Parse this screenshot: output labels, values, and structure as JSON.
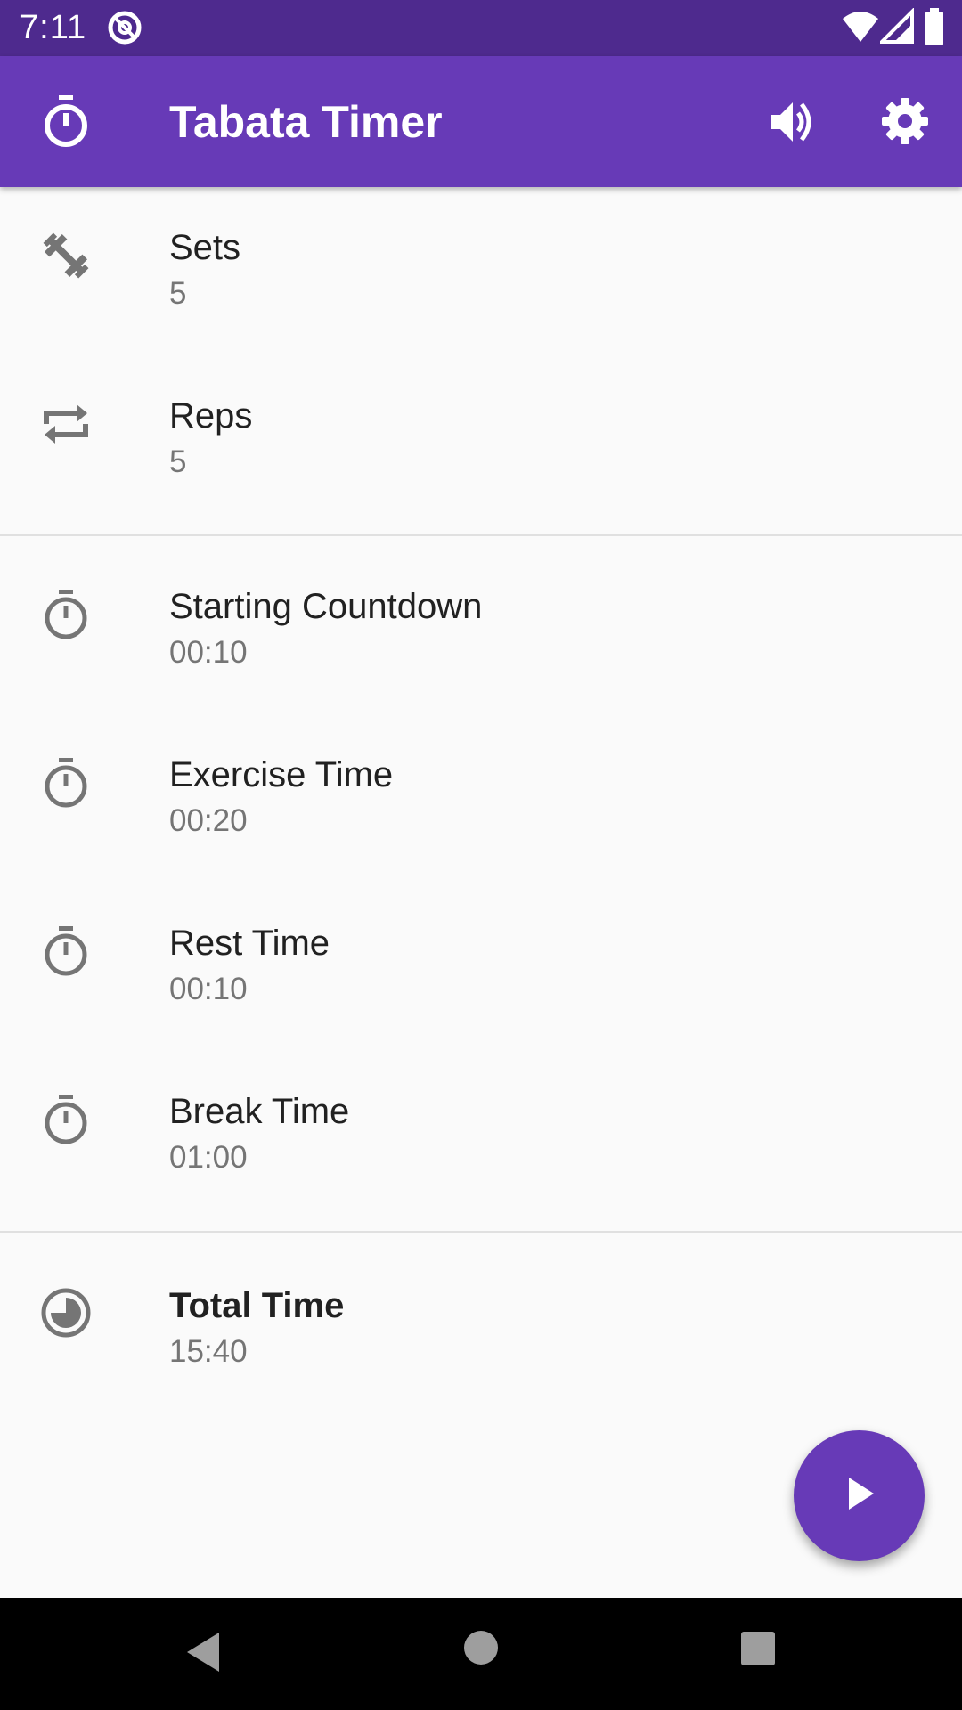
{
  "status_bar": {
    "time": "7:11",
    "icons": [
      "at-sign-icon",
      "wifi-icon",
      "signal-icon",
      "battery-icon"
    ]
  },
  "app_bar": {
    "title": "Tabata Timer",
    "leading_icon": "timer-icon",
    "actions": [
      "volume-up-icon",
      "settings-gear-icon"
    ]
  },
  "settings": [
    {
      "icon": "dumbbell-icon",
      "label": "Sets",
      "value": "5"
    },
    {
      "icon": "repeat-icon",
      "label": "Reps",
      "value": "5"
    },
    {
      "icon": "timer-icon",
      "label": "Starting Countdown",
      "value": "00:10"
    },
    {
      "icon": "timer-icon",
      "label": "Exercise Time",
      "value": "00:20"
    },
    {
      "icon": "timer-icon",
      "label": "Rest Time",
      "value": "00:10"
    },
    {
      "icon": "timer-icon",
      "label": "Break Time",
      "value": "01:00"
    }
  ],
  "total": {
    "icon": "clock-pie-icon",
    "label": "Total Time",
    "value": "15:40"
  },
  "fab": {
    "icon": "play-icon"
  },
  "nav_bar": {
    "icons": [
      "back-triangle-icon",
      "home-circle-icon",
      "recents-square-icon"
    ]
  },
  "colors": {
    "primary": "#673ab7",
    "primary_dark": "#4e2a8e",
    "background": "#fafafa",
    "text_primary": "#212121",
    "text_secondary": "#757575",
    "icon_gray": "#757575"
  }
}
